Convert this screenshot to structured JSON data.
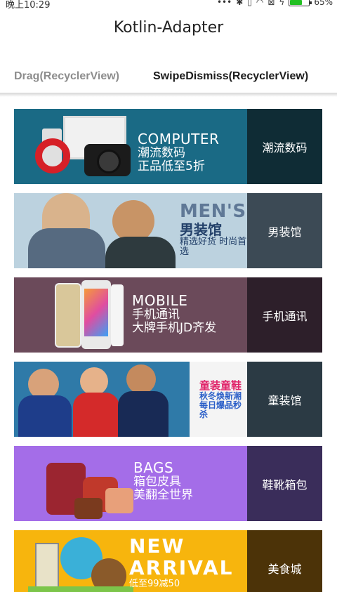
{
  "status_bar": {
    "time": "晚上10:29",
    "icons": [
      "more-dots-icon",
      "bluetooth-icon",
      "vibrate-icon",
      "wifi-icon",
      "sim-off-icon",
      "charging-icon"
    ],
    "battery_percent": "65%",
    "battery_level": 0.65
  },
  "toolbar": {
    "title": "Kotlin-Adapter"
  },
  "tabs": [
    {
      "label": "Drag(RecyclerView)",
      "selected": false
    },
    {
      "label": "SwipeDismiss(RecyclerView)",
      "selected": true
    }
  ],
  "cards": [
    {
      "promo_en": "COMPUTER",
      "promo_cn1": "潮流数码",
      "promo_cn2": "正品低至5折",
      "label": "潮流数码",
      "bg": "#1a6a85",
      "side_bg": "#0f2c35"
    },
    {
      "promo_en": "MEN'S",
      "promo_cn1": "男装馆",
      "promo_cn2": "精选好货 时尚首选",
      "label": "男装馆",
      "bg": "#bcd2df",
      "side_bg": "#3c4a55"
    },
    {
      "promo_en": "MOBILE",
      "promo_cn1": "手机通讯",
      "promo_cn2": "大牌手机JD齐发",
      "label": "手机通讯",
      "bg": "#6b4a5a",
      "side_bg": "#2d1f2a"
    },
    {
      "promo_en": "童装童鞋",
      "promo_cn1": "秋冬焕新潮",
      "promo_cn2": "每日爆品秒杀",
      "label": "童装馆",
      "bg": "#2f7aa8",
      "side_bg": "#2b3a44"
    },
    {
      "promo_en": "BAGS",
      "promo_cn1": "箱包皮具",
      "promo_cn2": "美翻全世界",
      "label": "鞋靴箱包",
      "bg": "#a46de8",
      "side_bg": "#3a2d5a"
    },
    {
      "promo_en": "NEW",
      "promo_cn1": "ARRIVAL",
      "promo_cn2": "低至99减50",
      "label": "美食城",
      "bg": "#f7b50d",
      "side_bg": "#4c3308"
    }
  ]
}
